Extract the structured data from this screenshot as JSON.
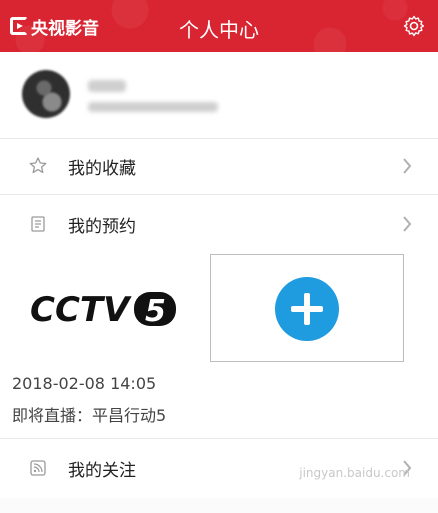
{
  "header": {
    "brand": "央视影音",
    "title": "个人中心",
    "settings_icon": "gear-icon",
    "bg_color": "#d92431"
  },
  "menu": [
    {
      "label": "我的收藏",
      "icon": "star-icon"
    },
    {
      "label": "我的预约",
      "icon": "document-icon"
    },
    {
      "label": "我的关注",
      "icon": "rss-icon"
    }
  ],
  "reservation": {
    "channel_logo": "CCTV5",
    "datetime": "2018-02-08 14:05",
    "live_text": "即将直播：平昌行动5",
    "add_icon": "plus-icon",
    "accent": "#1f9be0"
  },
  "watermark": "jingyan.baidu.com"
}
